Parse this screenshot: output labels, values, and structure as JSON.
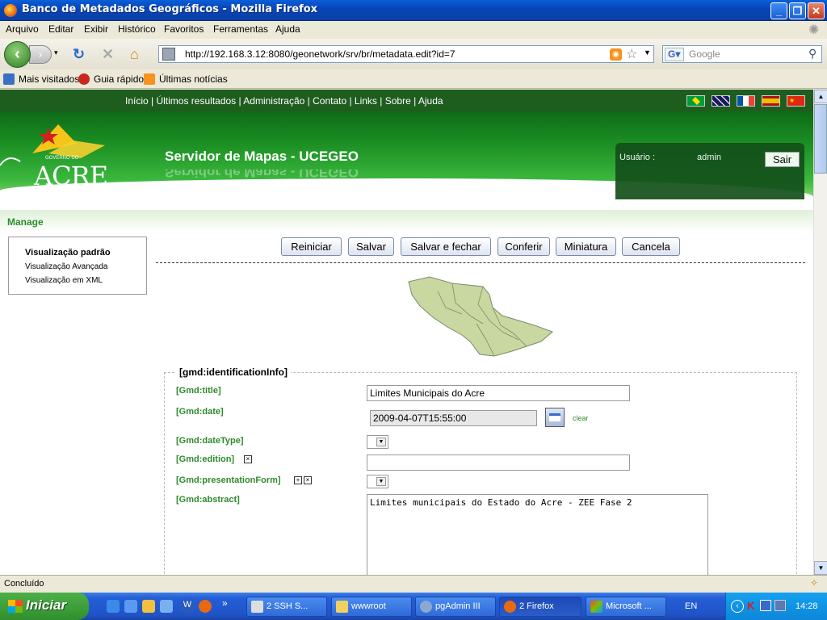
{
  "window": {
    "title": "Banco de Metadados Geográficos - Mozilla Firefox"
  },
  "menu": [
    "Arquivo",
    "Editar",
    "Exibir",
    "Histórico",
    "Favoritos",
    "Ferramentas",
    "Ajuda"
  ],
  "url": "http://192.168.3.12:8080/geonetwork/srv/br/metadata.edit?id=7",
  "search_placeholder": "Google",
  "bookmarks": [
    "Mais visitados",
    "Guia rápido",
    "Últimas notícias"
  ],
  "site": {
    "toplinks": "Início | Últimos resultados | Administração | Contato | Links | Sobre | Ajuda",
    "logo_small": "GOVERNO DO",
    "logo_big": "ACRE",
    "title": "Servidor de Mapas - UCEGEO",
    "user_label": "Usuário :",
    "user_value": "admin",
    "logout": "Sair",
    "manage": "Manage"
  },
  "sidebar": [
    "Visualização padrão",
    "Visualização Avançada",
    "Visualização em XML"
  ],
  "buttons": [
    "Reiniciar",
    "Salvar",
    "Salvar e fechar",
    "Conferir",
    "Miniatura",
    "Cancela"
  ],
  "form": {
    "legend": "[gmd:identificationInfo]",
    "title_label": "[Gmd:title]",
    "title_value": "Limites Municipais do Acre",
    "date_label": "[Gmd:date]",
    "date_value": "2009-04-07T15:55:00",
    "clear": "clear",
    "datetype_label": "[Gmd:dateType]",
    "edition_label": "[Gmd:edition]",
    "presentation_label": "[Gmd:presentationForm]",
    "abstract_label": "[Gmd:abstract]",
    "abstract_value": "Limites municipais do Estado do Acre - ZEE Fase 2"
  },
  "status": "Concluído",
  "taskbar": {
    "start": "Iniciar",
    "items": [
      "2 SSH S...",
      "wwwroot",
      "pgAdmin III",
      "2 Firefox",
      "Microsoft ..."
    ],
    "lang": "EN",
    "clock": "14:28"
  }
}
